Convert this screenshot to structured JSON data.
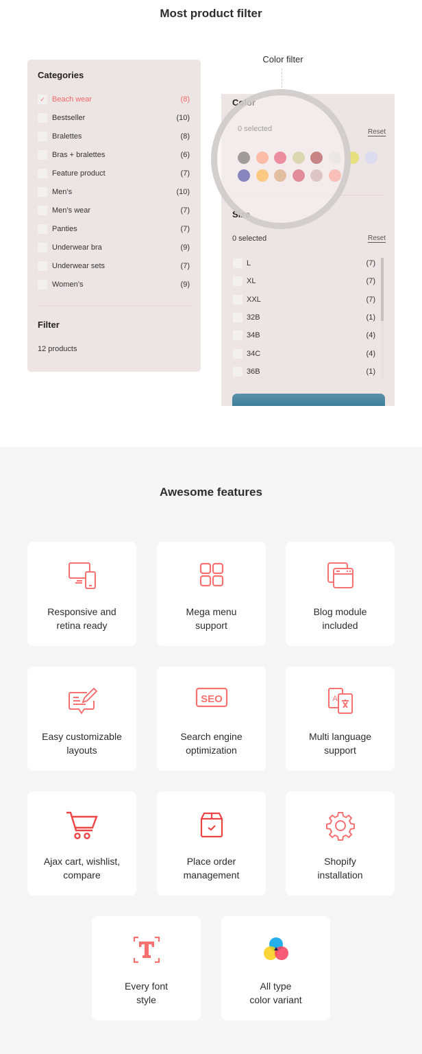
{
  "section1": {
    "title": "Most product filter",
    "callout": "Color filter"
  },
  "categories": {
    "heading": "Categories",
    "items": [
      {
        "label": "Beach wear",
        "count": "(8)",
        "checked": true
      },
      {
        "label": "Bestseller",
        "count": "(10)"
      },
      {
        "label": "Bralettes",
        "count": "(8)"
      },
      {
        "label": "Bras + bralettes",
        "count": "(6)"
      },
      {
        "label": "Feature product",
        "count": "(7)"
      },
      {
        "label": "Men’s",
        "count": "(10)"
      },
      {
        "label": "Men’s wear",
        "count": "(7)"
      },
      {
        "label": "Panties",
        "count": "(7)"
      },
      {
        "label": "Underwear bra",
        "count": "(9)"
      },
      {
        "label": "Underwear sets",
        "count": "(7)"
      },
      {
        "label": "Women’s",
        "count": "(9)"
      }
    ],
    "filter_heading": "Filter",
    "product_count": "12 products",
    "check_icon": "✓"
  },
  "color_filter": {
    "heading": "Color",
    "selected": "0 selected",
    "reset": "Reset",
    "swatches_row1": [
      "#333333",
      "#ff7b4f",
      "#dc143c",
      "#b5b565",
      "#8b0000",
      "#d9d9d9",
      "#e6e080",
      "#dcdcf0"
    ],
    "swatches_row2": [
      "#000080",
      "#ff9800",
      "#c8803c",
      "#c8102e",
      "#bc8f8f",
      "#fa8072"
    ]
  },
  "size_filter": {
    "heading": "Size",
    "selected": "0 selected",
    "reset": "Reset",
    "items": [
      {
        "label": "L",
        "count": "(7)"
      },
      {
        "label": "XL",
        "count": "(7)"
      },
      {
        "label": "XXL",
        "count": "(7)"
      },
      {
        "label": "32B",
        "count": "(1)"
      },
      {
        "label": "34B",
        "count": "(4)"
      },
      {
        "label": "34C",
        "count": "(4)"
      },
      {
        "label": "36B",
        "count": "(1)"
      }
    ]
  },
  "features": {
    "title": "Awesome features",
    "accent": "#f87171",
    "items": [
      {
        "label": "Responsive and\nretina ready",
        "icon": "devices-icon"
      },
      {
        "label": "Mega menu\nsupport",
        "icon": "grid-icon"
      },
      {
        "label": "Blog module\nincluded",
        "icon": "browser-windows-icon"
      },
      {
        "label": "Easy customizable\nlayouts",
        "icon": "edit-comment-icon"
      },
      {
        "label": "Search engine\noptimization",
        "icon": "seo-icon"
      },
      {
        "label": "Multi language\nsupport",
        "icon": "translate-icon"
      },
      {
        "label": "Ajax cart, wishlist,\ncompare",
        "icon": "cart-icon"
      },
      {
        "label": "Place order\nmanagement",
        "icon": "box-check-icon"
      },
      {
        "label": "Shopify\ninstallation",
        "icon": "gear-icon"
      },
      {
        "label": "Every font\nstyle",
        "icon": "font-icon"
      },
      {
        "label": "All type\ncolor variant",
        "icon": "color-circles-icon"
      }
    ]
  }
}
